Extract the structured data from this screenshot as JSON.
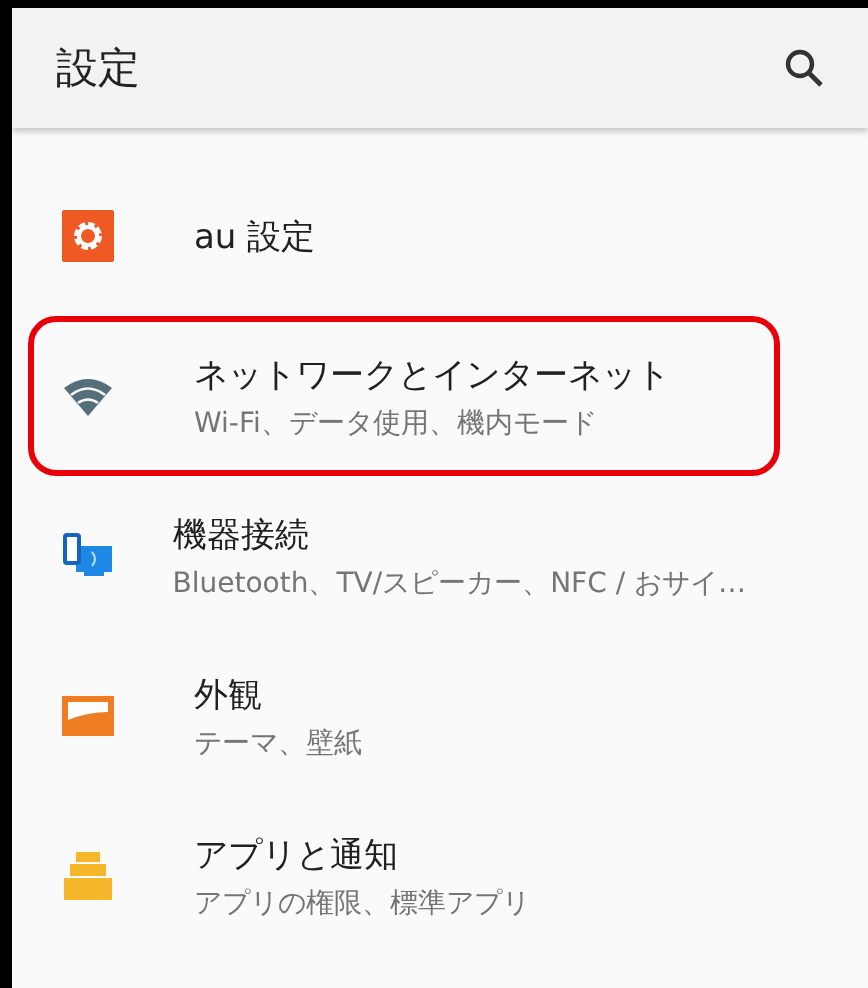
{
  "app_bar": {
    "title": "設定"
  },
  "items": [
    {
      "kind": "gear",
      "title": "au 設定",
      "highlighted": false
    },
    {
      "kind": "wifi",
      "title": "ネットワークとインターネット",
      "subtitle": "Wi-Fi、データ使用、機内モード",
      "highlighted": true
    },
    {
      "kind": "devices",
      "title": "機器接続",
      "subtitle": "Bluetooth、TV/スピーカー、NFC / おサイ…",
      "highlighted": false
    },
    {
      "kind": "display",
      "title": "外観",
      "subtitle": "テーマ、壁紙",
      "highlighted": false
    },
    {
      "kind": "apps",
      "title": "アプリと通知",
      "subtitle": "アプリの権限、標準アプリ",
      "highlighted": false
    }
  ]
}
